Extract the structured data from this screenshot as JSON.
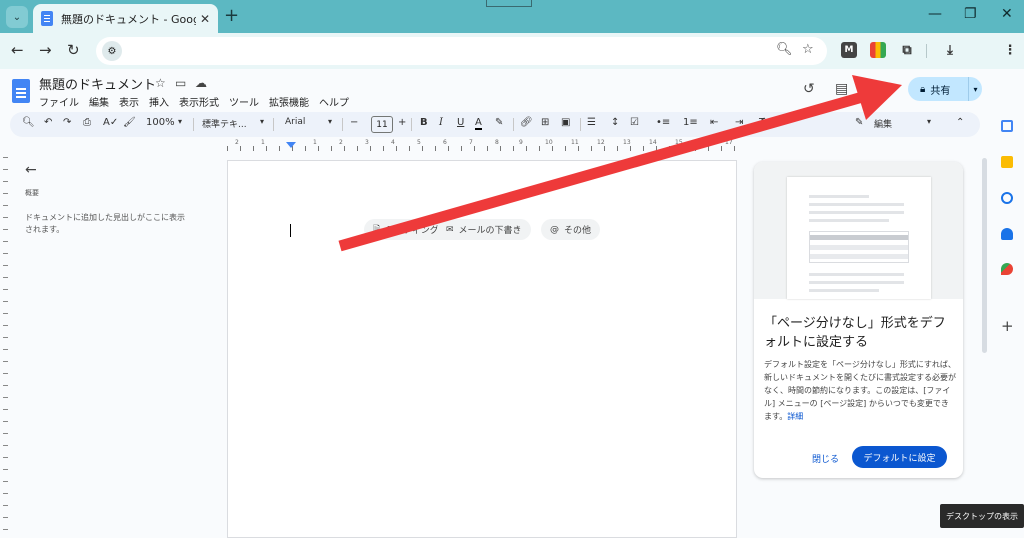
{
  "browser": {
    "tab_title": "無題のドキュメント - Google ドキュメント",
    "tab_close": "✕",
    "new_tab": "+",
    "minimize": "—",
    "restore": "❐",
    "close": "✕"
  },
  "docs": {
    "title": "無題のドキュメント",
    "menu": [
      "ファイル",
      "編集",
      "表示",
      "挿入",
      "表示形式",
      "ツール",
      "拡張機能",
      "ヘルプ"
    ],
    "share_label": "共有"
  },
  "toolbar": {
    "zoom": "100%",
    "style": "標準テキ...",
    "font": "Arial",
    "font_size": "11",
    "bold": "B",
    "italic": "I",
    "underline": "U",
    "text_color": "A",
    "edit_mode": "編集"
  },
  "ruler": {
    "labels": [
      "2",
      "1",
      "1",
      "2",
      "3",
      "4",
      "5",
      "6",
      "7",
      "8",
      "9",
      "10",
      "11",
      "12",
      "13",
      "14",
      "15",
      "16",
      "17",
      "18"
    ]
  },
  "outline": {
    "title": "概要",
    "empty_text": "ドキュメントに追加した見出しがここに表示されます。"
  },
  "document": {
    "chips": [
      {
        "label": "ミーティングメモ",
        "icon": "document-icon"
      },
      {
        "label": "メールの下書き",
        "icon": "mail-icon"
      },
      {
        "label": "その他",
        "icon": "at-icon"
      }
    ]
  },
  "promo": {
    "title": "「ページ分けなし」形式をデフォルトに設定する",
    "body": "デフォルト設定を「ページ分けなし」形式にすれば、新しいドキュメントを開くたびに書式設定する必要がなく、時間の節約になります。この設定は、[ファイル] メニューの [ページ設定] からいつでも変更できます。",
    "link": "詳細",
    "dismiss": "閉じる",
    "primary": "デフォルトに設定"
  },
  "tooltip": "デスクトップの表示",
  "colors": {
    "tabstrip": "#5cb8c2",
    "chrome_toolbar": "#e9f6f7",
    "docs_blue": "#4285f4",
    "share_bg": "#c2e7ff",
    "primary_button": "#0b57d0",
    "annotation_arrow": "#ee3a3a"
  }
}
